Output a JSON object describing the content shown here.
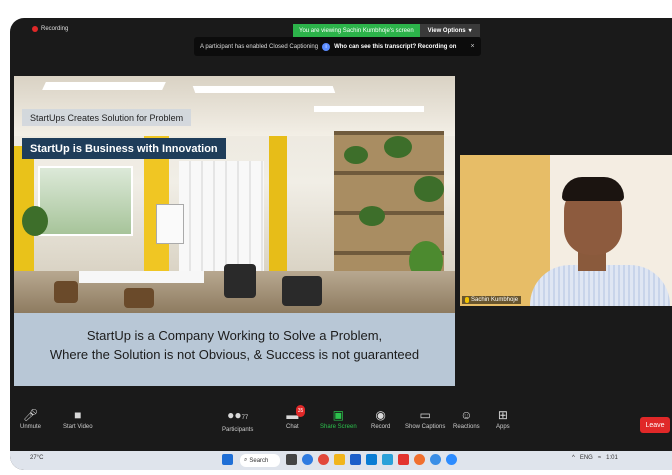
{
  "banner": {
    "sharing_text": "You are viewing Sachin Kumbhoje's screen",
    "options_label": "View Options"
  },
  "recording": {
    "label": "Recording"
  },
  "cc_notice": {
    "message": "A participant has enabled Closed Captioning",
    "question": "Who can see this transcript? Recording on",
    "close": "×"
  },
  "slide": {
    "subtitle": "StartUps Creates Solution for Problem",
    "title": "StartUp is Business with Innovation",
    "body_line1": "StartUp is a Company Working to Solve a Problem,",
    "body_line2": "Where the Solution is not Obvious, & Success is not guaranteed"
  },
  "webcam": {
    "name": "Sachin Kumbhoje"
  },
  "toolbar": {
    "unmute": "Unmute",
    "start_video": "Start Video",
    "participants": "Participants",
    "participants_count": "77",
    "chat": "Chat",
    "chat_badge": "35",
    "share_screen": "Share Screen",
    "record": "Record",
    "show_captions": "Show Captions",
    "reactions": "Reactions",
    "apps": "Apps",
    "leave": "Leave"
  },
  "taskbar": {
    "search_label": "Search",
    "weather": "27°C",
    "language": "ENG",
    "time": "1:01"
  },
  "colors": {
    "zoom_bg": "#1a1a1a",
    "share_green": "#2cb34a",
    "leave_red": "#e02828",
    "slide_title_bg": "#1f3d5a"
  },
  "icons": {
    "unmute": "mic-muted-icon",
    "video": "video-off-icon",
    "participants": "people-icon",
    "chat": "chat-icon",
    "share": "share-screen-icon",
    "record": "record-icon",
    "captions": "cc-icon",
    "reactions": "reaction-icon",
    "apps": "apps-icon"
  }
}
